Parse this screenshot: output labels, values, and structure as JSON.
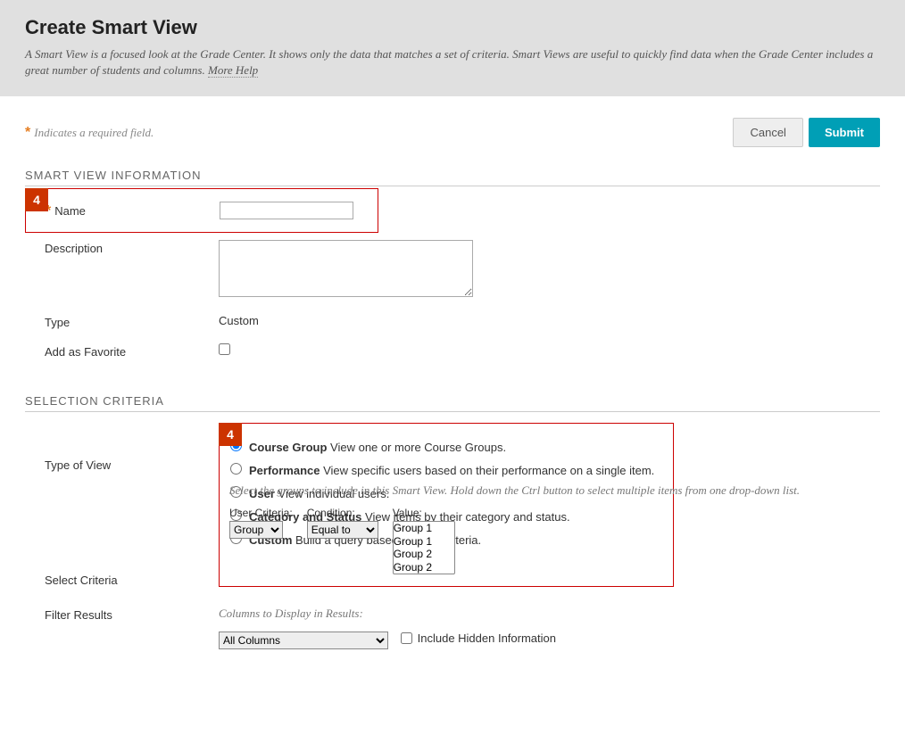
{
  "header": {
    "title": "Create Smart View",
    "description_pre": "A Smart View is a focused look at the Grade Center. It shows only the data that matches a set of criteria. Smart Views are useful to quickly find data when the Grade Center includes a great number of students and columns. ",
    "more_help": "More Help"
  },
  "required_note": "Indicates a required field.",
  "buttons": {
    "cancel": "Cancel",
    "submit": "Submit"
  },
  "section1": {
    "title": "SMART VIEW INFORMATION",
    "badge": "4",
    "name_label": "Name",
    "description_label": "Description",
    "type_label": "Type",
    "type_value": "Custom",
    "favorite_label": "Add as Favorite"
  },
  "section2": {
    "title": "SELECTION CRITERIA",
    "badge": "4",
    "type_of_view_label": "Type of View",
    "radios": [
      {
        "label": "Course Group",
        "desc": "View one or more Course Groups."
      },
      {
        "label": "Performance",
        "desc": "View specific users based on their performance on a single item."
      },
      {
        "label": "User",
        "desc": "View individual users."
      },
      {
        "label": "Category and Status",
        "desc": "View items by their category and status."
      },
      {
        "label": "Custom",
        "desc": "Build a query based on user criteria."
      }
    ],
    "select_criteria_label": "Select Criteria",
    "hint": "Select the groups to include in this Smart View. Hold down the Ctrl button to select multiple items from one drop-down list.",
    "user_criteria_label": "User Criteria:",
    "user_criteria_value": "Group",
    "condition_label": "Condition:",
    "condition_value": "Equal to",
    "value_label": "Value:",
    "value_options": [
      "Group 1",
      "Group 1",
      "Group 2",
      "Group 2"
    ],
    "filter_results_label": "Filter Results",
    "columns_display_label": "Columns to Display in Results:",
    "columns_value": "All Columns",
    "include_hidden_label": "Include Hidden Information"
  }
}
